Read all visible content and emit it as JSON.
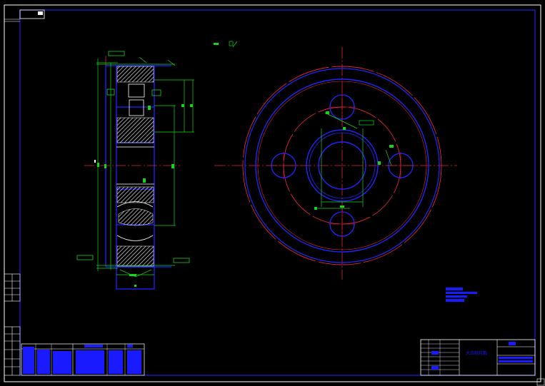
{
  "drawing": {
    "title_block_text": "大齿轮轮毂",
    "title_block_small_text": "",
    "tech_notes": []
  },
  "colors": {
    "background": "#000000",
    "frame": "#ffffff",
    "border": "#1f1fe0",
    "outline": "#2323ff",
    "centerline": "#e0233a",
    "dimension": "#18d418",
    "section": "#ffffff",
    "title_fill": "#1a1aff"
  }
}
